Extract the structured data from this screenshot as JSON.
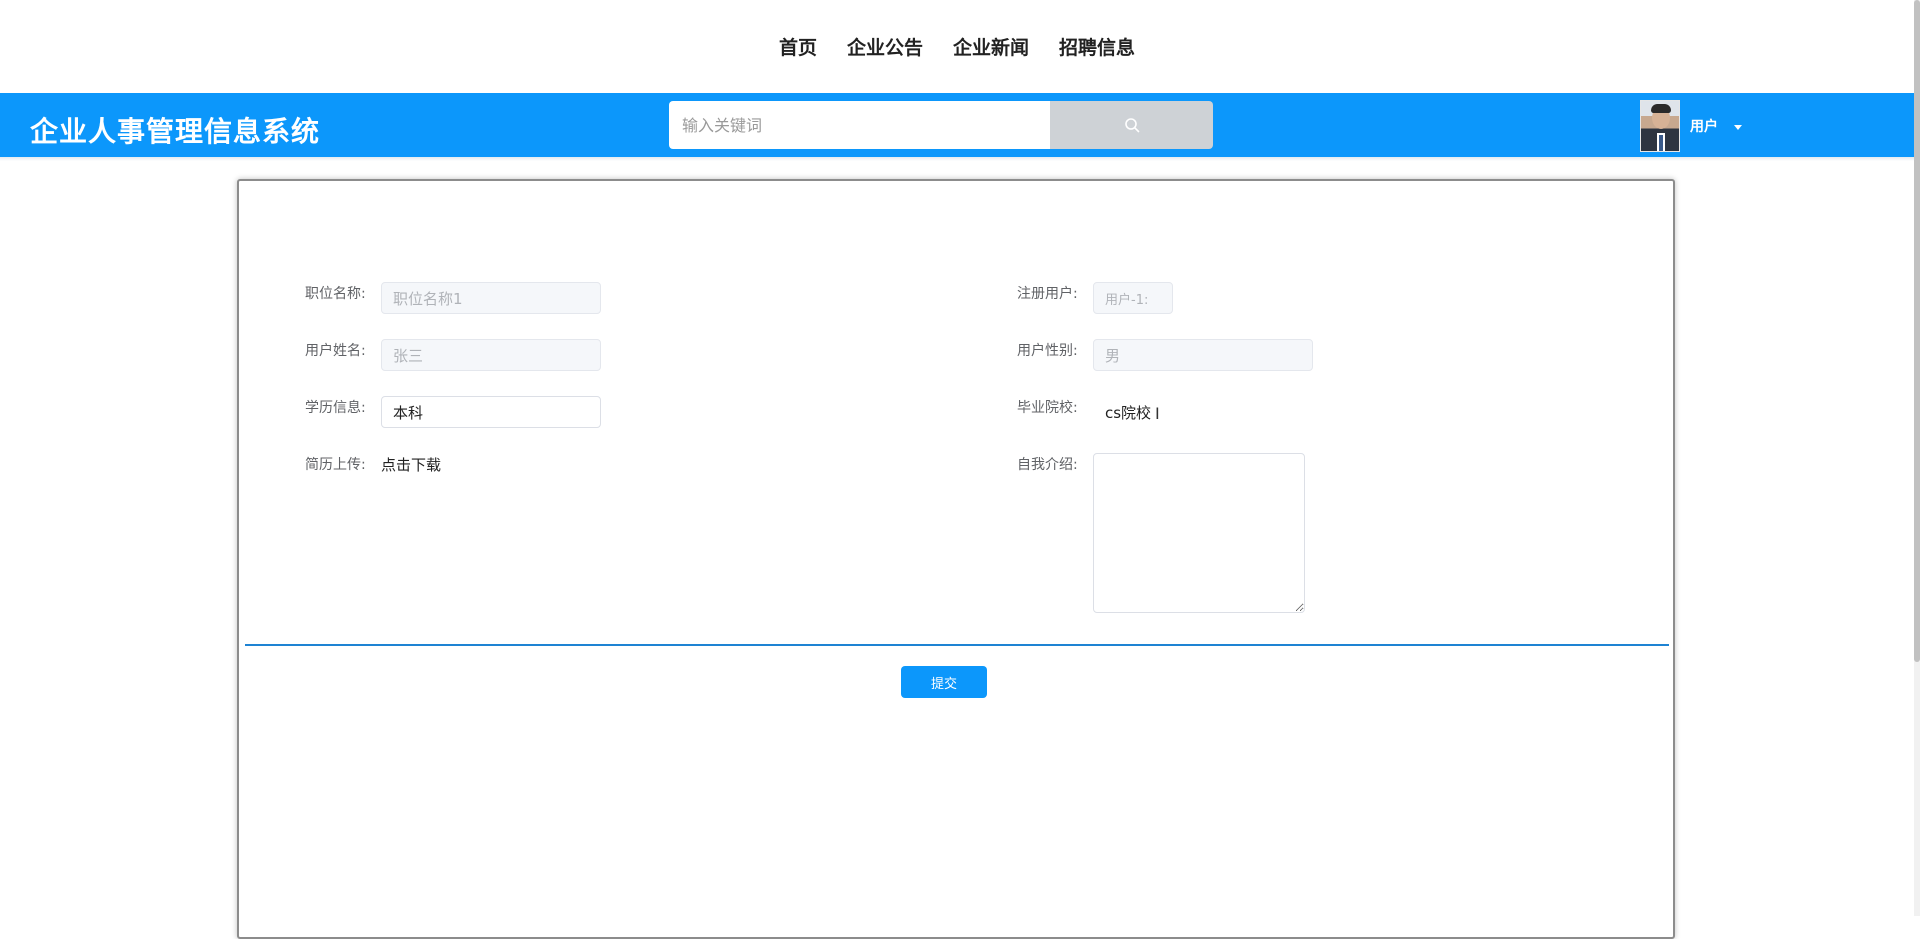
{
  "nav": {
    "items": [
      "首页",
      "企业公告",
      "企业新闻",
      "招聘信息"
    ]
  },
  "header": {
    "site_title": "企业人事管理信息系统",
    "search_placeholder": "输入关键词",
    "user_name": "用户"
  },
  "form": {
    "job_title": {
      "label": "职位名称:",
      "value": "职位名称1"
    },
    "account": {
      "label": "注册用户:",
      "value": "用户-1:"
    },
    "real_name": {
      "label": "用户姓名:",
      "value": "张三"
    },
    "gender": {
      "label": "用户性别:",
      "value": "男"
    },
    "education": {
      "label": "学历信息:",
      "value": "本科"
    },
    "school": {
      "label": "毕业院校:",
      "value": "cs院校"
    },
    "resume": {
      "label": "简历上传:",
      "link": "点击下载"
    },
    "intro": {
      "label": "自我介绍:",
      "value": ""
    },
    "submit_label": "提交"
  },
  "colors": {
    "accent": "#0c97fb",
    "divider": "#1e83d3"
  },
  "icons": {
    "search": "search-icon",
    "caret": "caret-down-icon",
    "avatar": "avatar-photo"
  }
}
